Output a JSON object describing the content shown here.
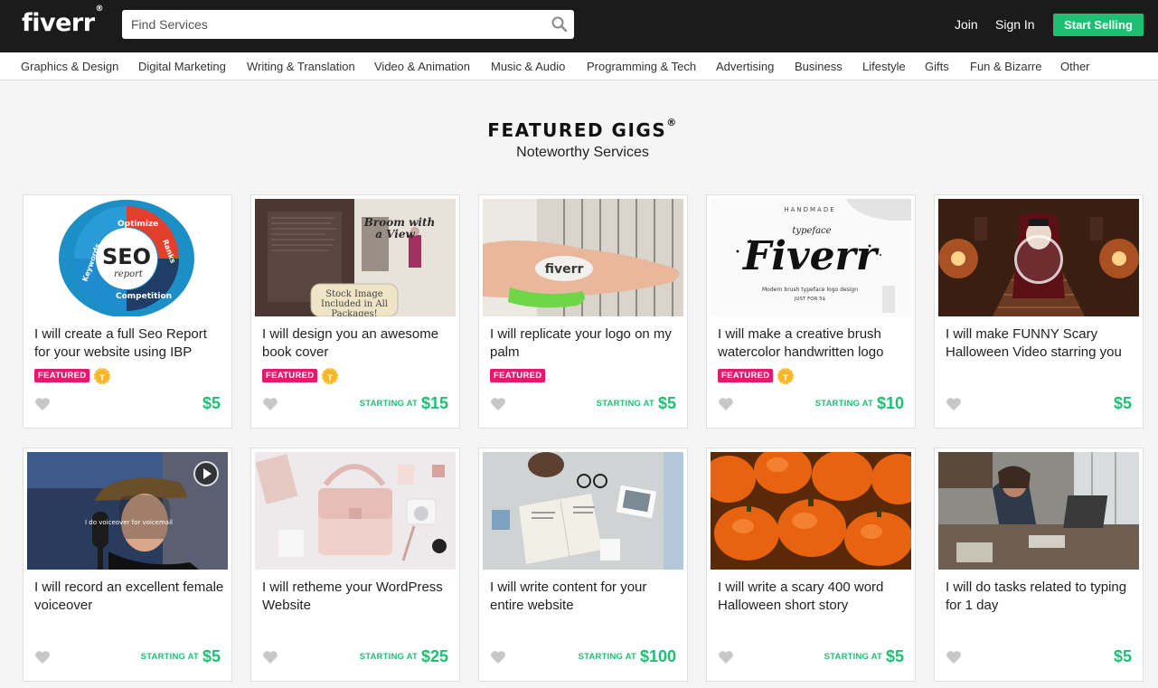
{
  "header": {
    "logo": "fiverr",
    "logo_mark": "®",
    "search_placeholder": "Find Services",
    "join": "Join",
    "sign_in": "Sign In",
    "start_selling": "Start Selling"
  },
  "categories": [
    "Graphics & Design",
    "Digital Marketing",
    "Writing & Translation",
    "Video & Animation",
    "Music & Audio",
    "Programming & Tech",
    "Advertising",
    "Business",
    "Lifestyle",
    "Gifts",
    "Fun & Bizarre",
    "Other"
  ],
  "section": {
    "title": "FEATURED GIGS",
    "title_mark": "®",
    "subtitle": "Noteworthy Services"
  },
  "gigs": [
    {
      "title": "I will create a full Seo Report for your website using IBP",
      "featured": "FEATURED",
      "top_badge": "T",
      "starting": "",
      "price": "$5"
    },
    {
      "title": "I will design you an awesome book cover",
      "featured": "FEATURED",
      "top_badge": "T",
      "starting": "STARTING AT",
      "price": "$15"
    },
    {
      "title": "I will replicate your logo on my palm",
      "featured": "FEATURED",
      "top_badge": "",
      "starting": "STARTING AT",
      "price": "$5"
    },
    {
      "title": "I will make a creative brush watercolor handwritten logo",
      "featured": "FEATURED",
      "top_badge": "T",
      "starting": "STARTING AT",
      "price": "$10"
    },
    {
      "title": "I will make FUNNY Scary Halloween Video starring you",
      "featured": "",
      "top_badge": "",
      "starting": "",
      "price": "$5"
    },
    {
      "title": "I will record an excellent female voiceover",
      "featured": "",
      "top_badge": "",
      "starting": "STARTING AT",
      "price": "$5"
    },
    {
      "title": "I will retheme your WordPress Website",
      "featured": "",
      "top_badge": "",
      "starting": "STARTING AT",
      "price": "$25"
    },
    {
      "title": "I will write content for your entire website",
      "featured": "",
      "top_badge": "",
      "starting": "STARTING AT",
      "price": "$100"
    },
    {
      "title": "I will write a scary 400 word Halloween short story",
      "featured": "",
      "top_badge": "",
      "starting": "STARTING AT",
      "price": "$5"
    },
    {
      "title": "I will do tasks related to typing for 1 day",
      "featured": "",
      "top_badge": "",
      "starting": "",
      "price": "$5"
    }
  ],
  "thumb_text": {
    "seo_main": "SEO",
    "seo_sub": "report",
    "seo_optimize": "Optimize",
    "seo_ranks": "Ranks",
    "seo_keywords": "Keywords",
    "seo_competition": "Competition",
    "book_title_1": "Broom with",
    "book_title_2": "a View",
    "book_stamp_1": "Stock Image",
    "book_stamp_2": "Included in All",
    "book_stamp_3": "Packages!",
    "palm_logo": "fiverr",
    "brush_top": "HANDMADE",
    "brush_small": "typeface",
    "brush_main": "Fiverr",
    "brush_desc": "Modern brush typeface logo design",
    "brush_price": "JUST FOR 5$",
    "voice_caption": "I do voiceover for voicemail"
  },
  "colors": {
    "accent": "#1dbf73",
    "featured": "#e5196d",
    "topbar": "#1b1b1b",
    "top_rated": "#f7b529"
  }
}
